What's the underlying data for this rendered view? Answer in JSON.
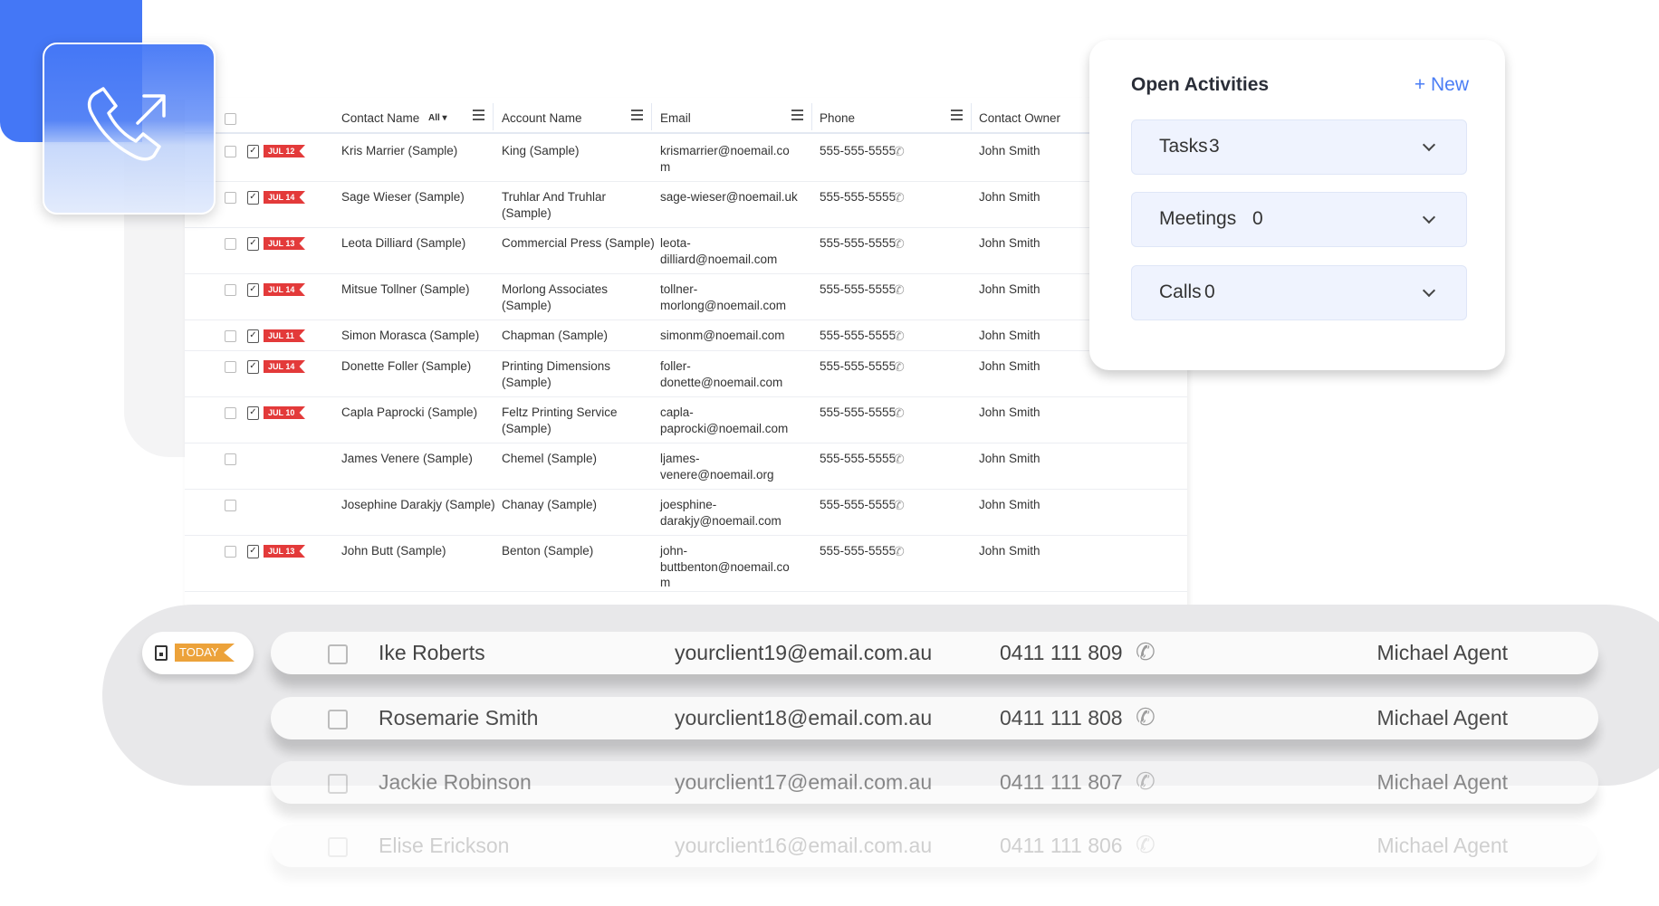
{
  "table": {
    "headers": {
      "contact_name": "Contact Name",
      "filter": "All",
      "account_name": "Account Name",
      "email": "Email",
      "phone": "Phone",
      "contact_owner": "Contact Owner"
    },
    "rows": [
      {
        "badge": "JUL 12",
        "contact": "Kris Marrier (Sample)",
        "account": [
          "King (Sample)"
        ],
        "email": [
          "krismarrier@noemail.co",
          "m"
        ],
        "phone": "555-555-5555",
        "owner": "John Smith"
      },
      {
        "badge": "JUL 14",
        "contact": "Sage Wieser (Sample)",
        "account": [
          "Truhlar And Truhlar",
          "(Sample)"
        ],
        "email": [
          "sage-wieser@noemail.uk"
        ],
        "phone": "555-555-5555",
        "owner": "John Smith"
      },
      {
        "badge": "JUL 13",
        "contact": "Leota Dilliard (Sample)",
        "account": [
          "Commercial Press (Sample)"
        ],
        "email": [
          "leota-",
          "dilliard@noemail.com"
        ],
        "phone": "555-555-5555",
        "owner": "John Smith"
      },
      {
        "badge": "JUL 14",
        "contact": "Mitsue Tollner (Sample)",
        "account": [
          "Morlong Associates",
          "(Sample)"
        ],
        "email": [
          "tollner-",
          "morlong@noemail.com"
        ],
        "phone": "555-555-5555",
        "owner": "John Smith"
      },
      {
        "badge": "JUL 11",
        "contact": "Simon Morasca (Sample)",
        "account": [
          "Chapman (Sample)"
        ],
        "email": [
          "simonm@noemail.com"
        ],
        "phone": "555-555-5555",
        "owner": "John Smith"
      },
      {
        "badge": "JUL 14",
        "contact": "Donette Foller (Sample)",
        "account": [
          "Printing Dimensions",
          "(Sample)"
        ],
        "email": [
          "foller-",
          "donette@noemail.com"
        ],
        "phone": "555-555-5555",
        "owner": "John Smith"
      },
      {
        "badge": "JUL 10",
        "contact": "Capla Paprocki (Sample)",
        "account": [
          "Feltz Printing Service",
          "(Sample)"
        ],
        "email": [
          "capla-",
          "paprocki@noemail.com"
        ],
        "phone": "555-555-5555",
        "owner": "John Smith"
      },
      {
        "badge": null,
        "contact": "James Venere (Sample)",
        "account": [
          "Chemel (Sample)"
        ],
        "email": [
          "ljames-",
          "venere@noemail.org"
        ],
        "phone": "555-555-5555",
        "owner": "John Smith"
      },
      {
        "badge": null,
        "contact": "Josephine Darakjy (Sample)",
        "account": [
          "Chanay (Sample)"
        ],
        "email": [
          "joesphine-",
          "darakjy@noemail.com"
        ],
        "phone": "555-555-5555",
        "owner": "John Smith"
      },
      {
        "badge": "JUL 13",
        "contact": "John Butt (Sample)",
        "account": [
          "Benton (Sample)"
        ],
        "email": [
          "john-",
          "buttbenton@noemail.co",
          "m"
        ],
        "phone": "555-555-5555",
        "owner": "John Smith"
      }
    ]
  },
  "open_activities": {
    "title": "Open Activities",
    "new_label": "+ New",
    "items": [
      {
        "label": "Tasks",
        "count": "3"
      },
      {
        "label": "Meetings",
        "count": "0"
      },
      {
        "label": "Calls",
        "count": "0"
      }
    ]
  },
  "today": {
    "label": "TODAY",
    "rows": [
      {
        "name": "Ike Roberts",
        "email": "yourclient19@email.com.au",
        "phone": "0411 111 809",
        "agent": "Michael Agent"
      },
      {
        "name": "Rosemarie Smith",
        "email": "yourclient18@email.com.au",
        "phone": "0411 111 808",
        "agent": "Michael Agent"
      },
      {
        "name": "Jackie Robinson",
        "email": "yourclient17@email.com.au",
        "phone": "0411 111 807",
        "agent": "Michael Agent"
      },
      {
        "name": "Elise Erickson",
        "email": "yourclient16@email.com.au",
        "phone": "0411 111 806",
        "agent": "Michael Agent"
      }
    ]
  },
  "colors": {
    "brand_blue": "#4477f6",
    "badge_red": "#e33a3a",
    "today_orange": "#eca23a",
    "link_blue": "#4a7df5"
  },
  "icons": {
    "hero": "phone-outgoing-icon",
    "row_task": "task-clipboard-icon",
    "phone": "phone-icon",
    "chevron": "chevron-down-icon",
    "today": "calendar-icon"
  }
}
